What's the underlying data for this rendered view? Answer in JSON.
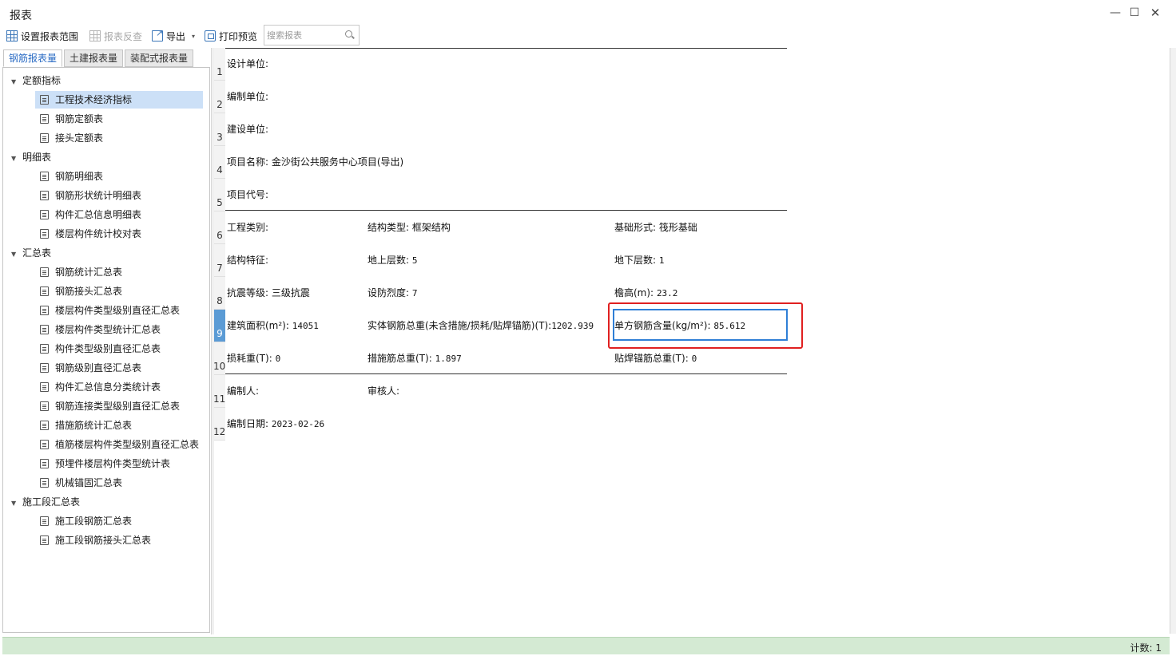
{
  "window": {
    "title": "报表",
    "minimize": "—",
    "maximize": "☐",
    "close": "✕"
  },
  "toolbar": {
    "set_range": "设置报表范围",
    "report_reverse": "报表反查",
    "export": "导出",
    "export_caret": "▾",
    "print_preview": "打印预览",
    "search_placeholder": "搜索报表"
  },
  "tabs": [
    {
      "label": "钢筋报表量",
      "active": true
    },
    {
      "label": "土建报表量",
      "active": false
    },
    {
      "label": "装配式报表量",
      "active": false
    }
  ],
  "tree": {
    "groups": [
      {
        "label": "定额指标",
        "items": [
          "工程技术经济指标",
          "钢筋定额表",
          "接头定额表"
        ]
      },
      {
        "label": "明细表",
        "items": [
          "钢筋明细表",
          "钢筋形状统计明细表",
          "构件汇总信息明细表",
          "楼层构件统计校对表"
        ]
      },
      {
        "label": "汇总表",
        "items": [
          "钢筋统计汇总表",
          "钢筋接头汇总表",
          "楼层构件类型级别直径汇总表",
          "楼层构件类型统计汇总表",
          "构件类型级别直径汇总表",
          "钢筋级别直径汇总表",
          "构件汇总信息分类统计表",
          "钢筋连接类型级别直径汇总表",
          "措施筋统计汇总表",
          "植筋楼层构件类型级别直径汇总表",
          "预埋件楼层构件类型统计表",
          "机械锚固汇总表"
        ]
      },
      {
        "label": "施工段汇总表",
        "items": [
          "施工段钢筋汇总表",
          "施工段钢筋接头汇总表"
        ]
      }
    ],
    "selected": "工程技术经济指标"
  },
  "report": {
    "row_numbers": [
      "1",
      "2",
      "3",
      "4",
      "5",
      "6",
      "7",
      "8",
      "9",
      "10",
      "11",
      "12"
    ],
    "selected_row": "9",
    "design_unit": "设计单位:",
    "compile_unit": "编制单位:",
    "build_unit": "建设单位:",
    "project_name_label": "项目名称:",
    "project_name": "金沙街公共服务中心项目(导出)",
    "project_code": "项目代号:",
    "project_type": "工程类别:",
    "structure_type_label": "结构类型:",
    "structure_type": "框架结构",
    "foundation_label": "基础形式:",
    "foundation": "筏形基础",
    "structure_feature": "结构特征:",
    "floors_above_label": "地上层数:",
    "floors_above": "5",
    "floors_below_label": "地下层数:",
    "floors_below": "1",
    "seismic_grade_label": "抗震等级:",
    "seismic_grade": "三级抗震",
    "fortification_label": "设防烈度:",
    "fortification": "7",
    "eave_height_label": "檐高(m):",
    "eave_height": "23.2",
    "building_area_label": "建筑面积(m²):",
    "building_area": "14051",
    "rebar_total_label": "实体钢筋总重(未含措施/损耗/贴焊锚筋)(T):",
    "rebar_total": "1202.939",
    "rebar_per_area_label": "单方钢筋含量(kg/m²):",
    "rebar_per_area": "85.612",
    "loss_weight_label": "损耗重(T):",
    "loss_weight": "0",
    "measure_rebar_label": "措施筋总重(T):",
    "measure_rebar": "1.897",
    "weld_anchor_label": "贴焊锚筋总重(T):",
    "weld_anchor": "0",
    "compiler": "编制人:",
    "reviewer": "审核人:",
    "compile_date_label": "编制日期:",
    "compile_date": "2023-02-26"
  },
  "status": {
    "count_label": "计数:",
    "count": "1"
  },
  "colors": {
    "accent": "#2b6cc4",
    "selected_row": "#5b9bd5",
    "highlight": "#e02020",
    "statusbar": "#d4ead3"
  }
}
